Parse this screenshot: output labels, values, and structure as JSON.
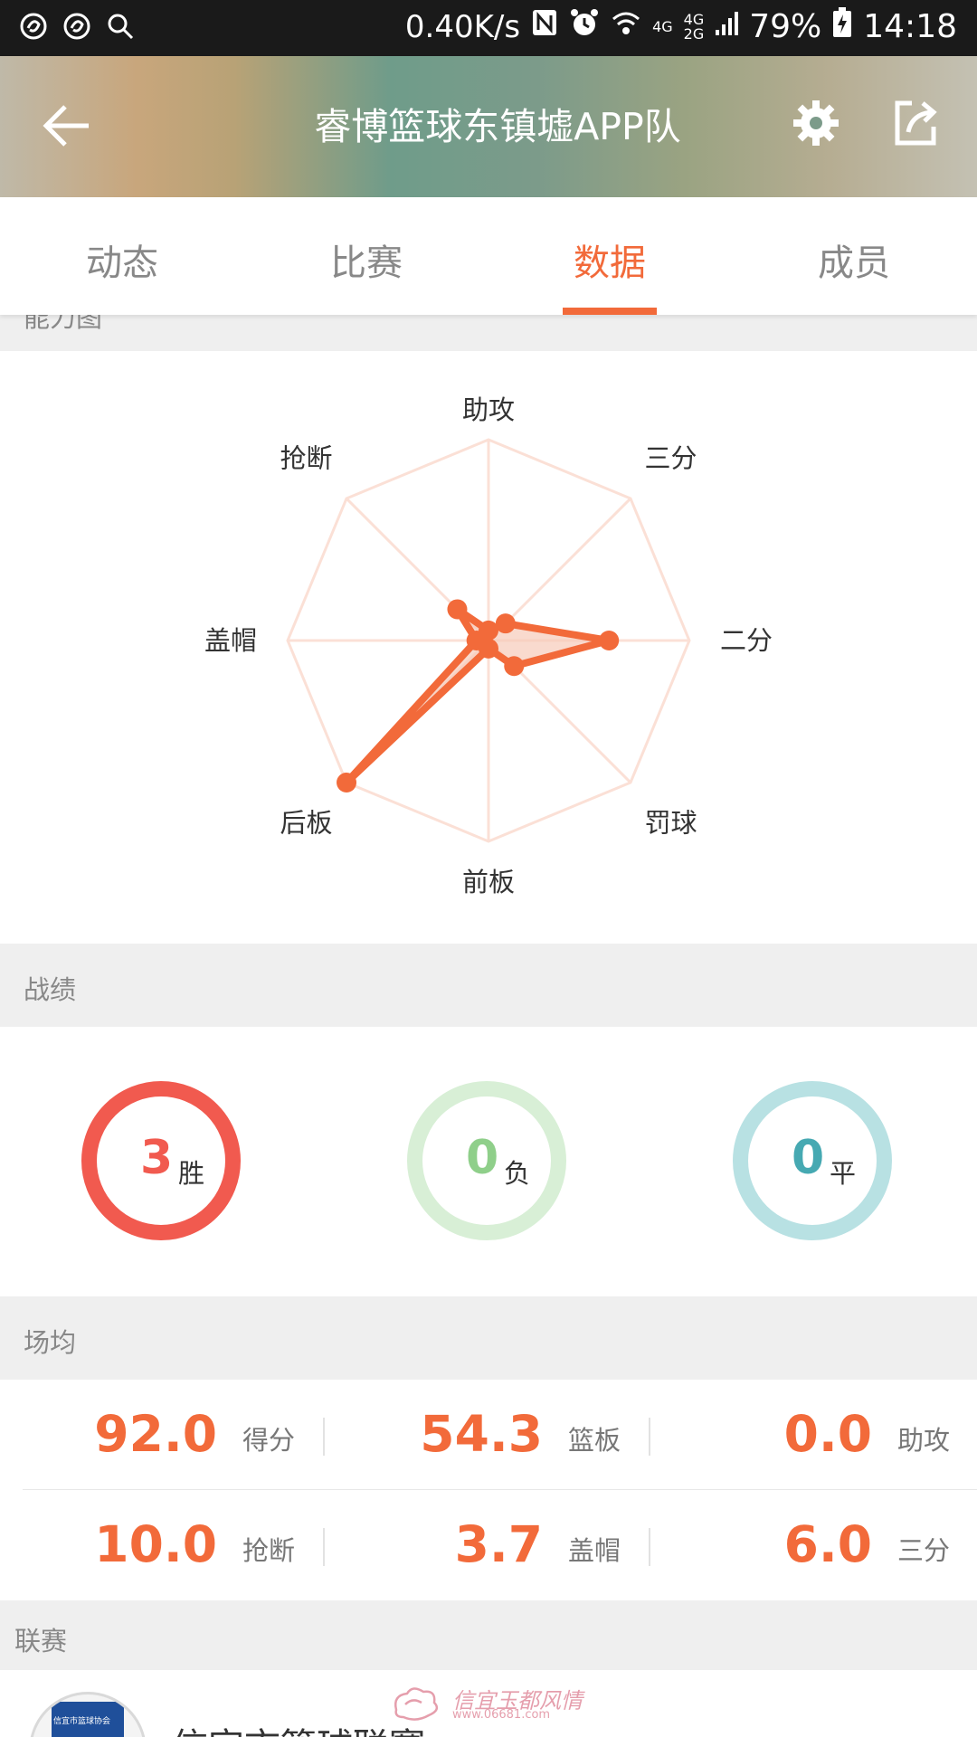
{
  "status_bar": {
    "net_speed": "0.40K/s",
    "net_4g": "4G",
    "net_4g2": "4G",
    "net_2g": "2G",
    "battery": "79%",
    "time": "14:18",
    "icons": [
      "netease-icon",
      "netease-icon",
      "search-icon",
      "nfc-icon",
      "alarm-icon",
      "wifi-icon",
      "signal-icon",
      "battery-charging-icon"
    ]
  },
  "header": {
    "title": "睿博篮球东镇墟APP队",
    "back_icon": "arrow-left-icon",
    "settings_icon": "gear-icon",
    "share_icon": "share-icon"
  },
  "tabs": [
    {
      "label": "动态",
      "active": false
    },
    {
      "label": "比赛",
      "active": false
    },
    {
      "label": "数据",
      "active": true
    },
    {
      "label": "成员",
      "active": false
    }
  ],
  "ability": {
    "section_title": "能力图",
    "axes": [
      "助攻",
      "三分",
      "二分",
      "罚球",
      "前板",
      "后板",
      "盖帽",
      "抢断"
    ],
    "values": [
      0.05,
      0.12,
      0.6,
      0.18,
      0.04,
      1.0,
      0.06,
      0.22
    ],
    "colors": {
      "line": "#f26a3a",
      "fill": "#f7cbb9",
      "grid": "#fbe0d6"
    }
  },
  "record": {
    "section_title": "战绩",
    "items": [
      {
        "value": "3",
        "unit": "胜",
        "color": "#f15a4f"
      },
      {
        "value": "0",
        "unit": "负",
        "color": "#8fcf8a",
        "ring": "#d8efd6"
      },
      {
        "value": "0",
        "unit": "平",
        "color": "#46a9b2",
        "ring": "#b8e1e3"
      }
    ]
  },
  "averages": {
    "section_title": "场均",
    "row1": [
      {
        "value": "92.0",
        "label": "得分"
      },
      {
        "value": "54.3",
        "label": "篮板"
      },
      {
        "value": "0.0",
        "label": "助攻"
      }
    ],
    "row2": [
      {
        "value": "10.0",
        "label": "抢断"
      },
      {
        "value": "3.7",
        "label": "盖帽"
      },
      {
        "value": "6.0",
        "label": "三分"
      }
    ]
  },
  "league": {
    "section_title": "联赛",
    "name": "信宜市篮球联赛",
    "logo_text": "信宜市篮球协会"
  },
  "watermark": {
    "text": "信宜玉都风情",
    "url": "www.06681.com"
  }
}
